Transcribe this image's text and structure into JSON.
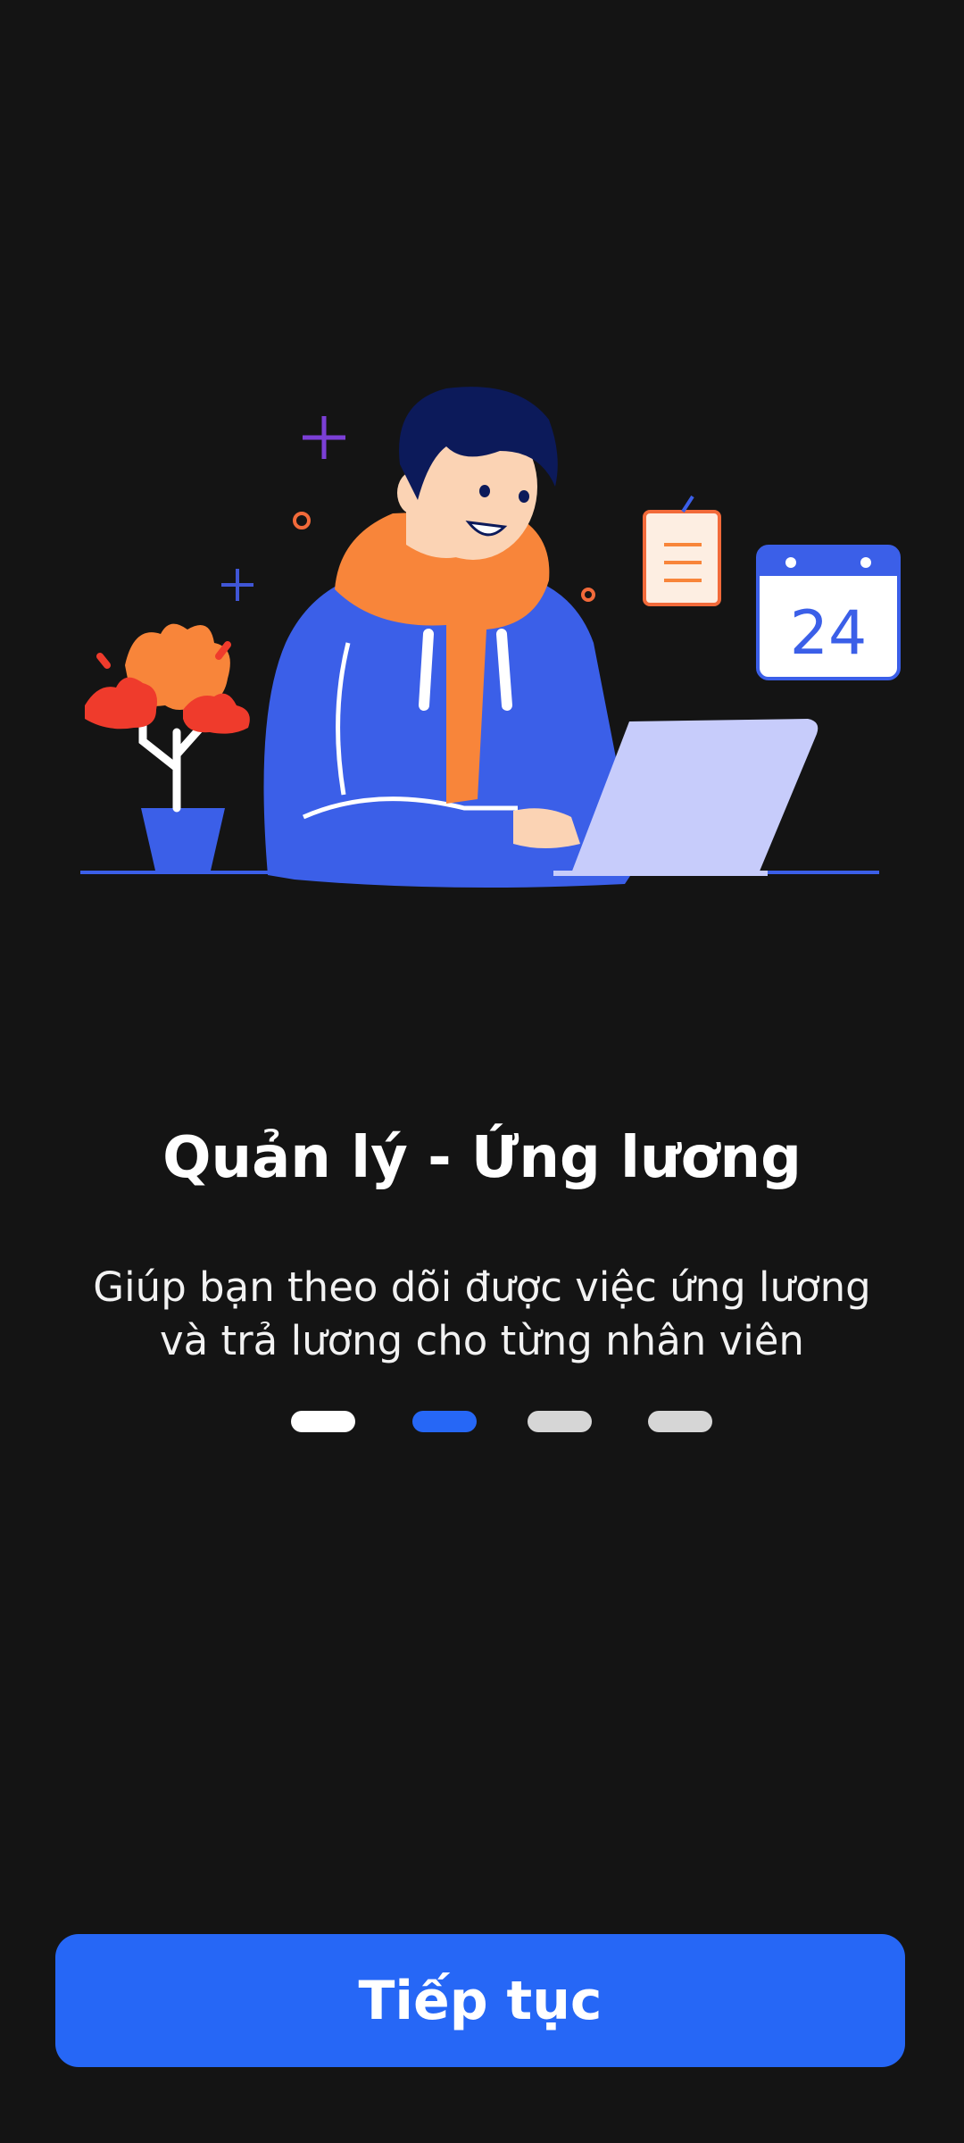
{
  "onboarding": {
    "title": "Quản lý - Ứng lương",
    "description_line1": "Giúp bạn theo dõi được việc ứng lương",
    "description_line2": "và trả lương cho từng nhân viên",
    "pagination": {
      "count": 4,
      "active_index": 1,
      "dots": [
        {
          "state": "inactive",
          "color": "#ffffff"
        },
        {
          "state": "active",
          "color": "#2667f6"
        },
        {
          "state": "inactive",
          "color": "#d6d6d6"
        },
        {
          "state": "inactive",
          "color": "#d6d6d6"
        }
      ]
    },
    "continue_button_label": "Tiếp tục",
    "illustration": {
      "calendar_day": "24"
    }
  },
  "colors": {
    "background": "#141414",
    "accent": "#2667f6",
    "scarf": "#f8853a",
    "hoodie": "#3b5fe8"
  }
}
